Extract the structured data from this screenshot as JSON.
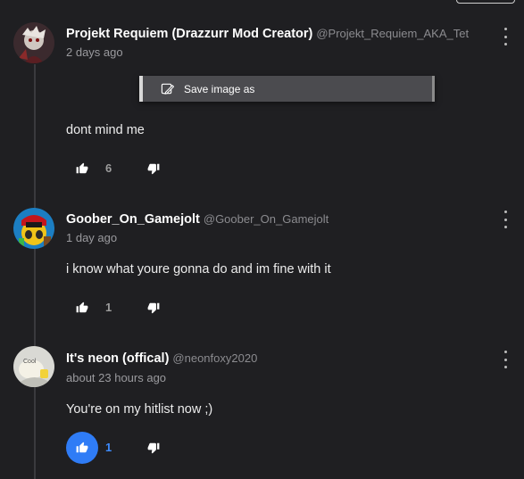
{
  "comments": [
    {
      "display_name": "Projekt Requiem (Drazzurr Mod Creator)",
      "handle": "@Projekt_Requiem_AKA_Tet",
      "timestamp": "2 days ago",
      "body": "dont mind me",
      "likes": "6",
      "liked": false
    },
    {
      "display_name": "Goober_On_Gamejolt",
      "handle": "@Goober_On_Gamejolt",
      "timestamp": "1 day ago",
      "body": "i know what youre gonna do and im fine with it",
      "likes": "1",
      "liked": false
    },
    {
      "display_name": "It's neon (offical)",
      "handle": "@neonfoxy2020",
      "timestamp": "about 23 hours ago",
      "body": "You're on my hitlist now ;)",
      "likes": "1",
      "liked": true,
      "avatar_text": "Cool"
    }
  ],
  "context_menu": {
    "item_label": "Save image as",
    "item_icon": "edit-image-icon"
  },
  "icons": {
    "like": "thumbs-up-icon",
    "dislike": "thumbs-down-icon",
    "more": "kebab-menu-icon"
  },
  "colors": {
    "background": "#1f1f22",
    "accent": "#2f7cf6",
    "liked_count": "#3d8bff",
    "muted": "#9a9a9e"
  }
}
